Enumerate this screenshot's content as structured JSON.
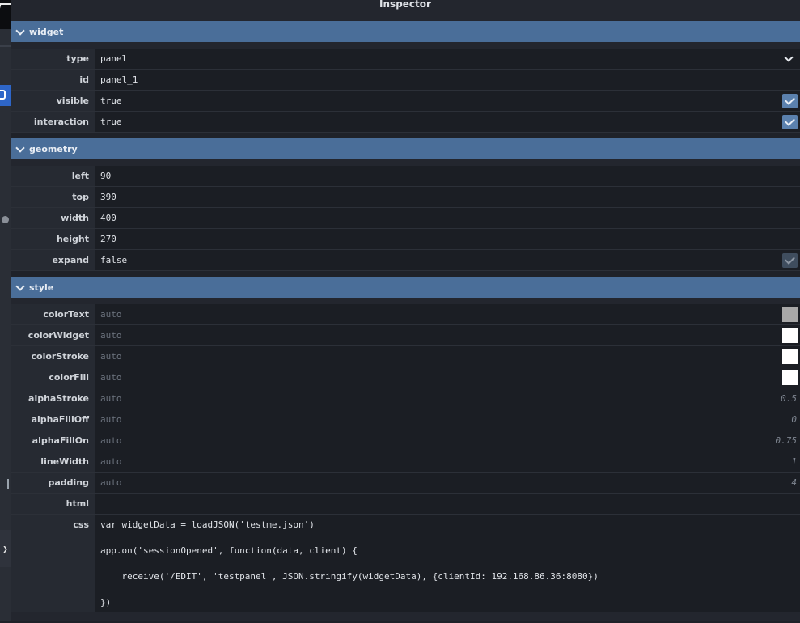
{
  "inspector": {
    "title": "Inspector"
  },
  "sections": {
    "widget": {
      "title": "widget",
      "type": {
        "label": "type",
        "value": "panel"
      },
      "id": {
        "label": "id",
        "value": "panel_1"
      },
      "visible": {
        "label": "visible",
        "value": "true"
      },
      "interaction": {
        "label": "interaction",
        "value": "true"
      }
    },
    "geometry": {
      "title": "geometry",
      "left": {
        "label": "left",
        "value": "90"
      },
      "top": {
        "label": "top",
        "value": "390"
      },
      "width": {
        "label": "width",
        "value": "400"
      },
      "height": {
        "label": "height",
        "value": "270"
      },
      "expand": {
        "label": "expand",
        "value": "false"
      }
    },
    "style": {
      "title": "style",
      "colorText": {
        "label": "colorText",
        "placeholder": "auto",
        "swatch": "#a8a8a8"
      },
      "colorWidget": {
        "label": "colorWidget",
        "placeholder": "auto",
        "swatch": "#ffffff"
      },
      "colorStroke": {
        "label": "colorStroke",
        "placeholder": "auto",
        "swatch": "#ffffff"
      },
      "colorFill": {
        "label": "colorFill",
        "placeholder": "auto",
        "swatch": "#ffffff"
      },
      "alphaStroke": {
        "label": "alphaStroke",
        "placeholder": "auto",
        "default": "0.5"
      },
      "alphaFillOff": {
        "label": "alphaFillOff",
        "placeholder": "auto",
        "default": "0"
      },
      "alphaFillOn": {
        "label": "alphaFillOn",
        "placeholder": "auto",
        "default": "0.75"
      },
      "lineWidth": {
        "label": "lineWidth",
        "placeholder": "auto",
        "default": "1"
      },
      "padding": {
        "label": "padding",
        "placeholder": "auto",
        "default": "4"
      },
      "html": {
        "label": "html",
        "value": ""
      },
      "css": {
        "label": "css",
        "lines": [
          "var widgetData = loadJSON('testme.json')",
          "app.on('sessionOpened', function(data, client) {",
          "    receive('/EDIT', 'testpanel', JSON.stringify(widgetData), {clientId: 192.168.86.36:8080})",
          "})"
        ]
      }
    }
  }
}
